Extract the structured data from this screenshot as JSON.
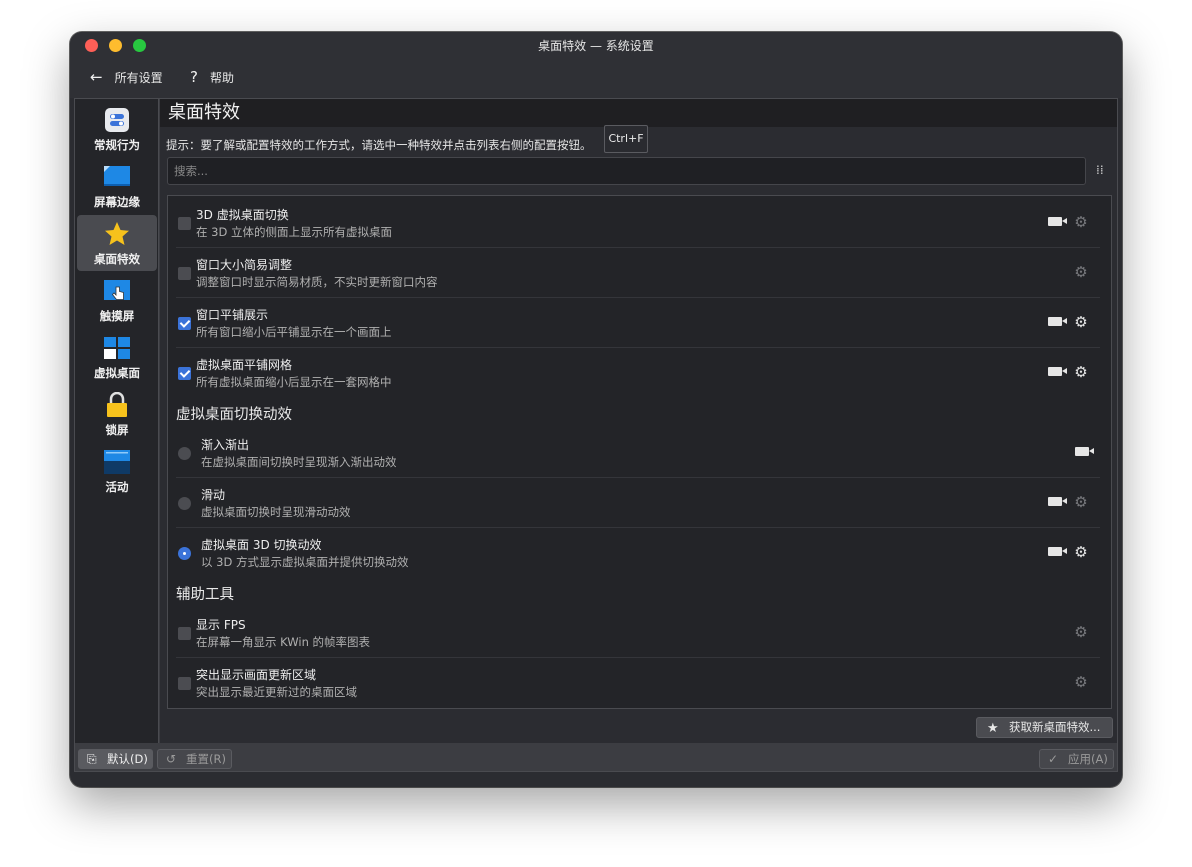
{
  "window": {
    "title": "桌面特效 — 系统设置"
  },
  "toolbar": {
    "back_label": "所有设置",
    "help_label": "帮助"
  },
  "sidebar": {
    "items": [
      {
        "label": "常规行为",
        "icon": "general-behavior-icon",
        "active": false
      },
      {
        "label": "屏幕边缘",
        "icon": "screen-edges-icon",
        "active": false
      },
      {
        "label": "桌面特效",
        "icon": "star-icon",
        "active": true
      },
      {
        "label": "触摸屏",
        "icon": "touchscreen-icon",
        "active": false
      },
      {
        "label": "虚拟桌面",
        "icon": "virtual-desktops-icon",
        "active": false
      },
      {
        "label": "锁屏",
        "icon": "lock-icon",
        "active": false
      },
      {
        "label": "活动",
        "icon": "activities-icon",
        "active": false
      }
    ]
  },
  "page": {
    "title": "桌面特效",
    "hint": "提示：要了解或配置特效的工作方式，请选中一种特效并点击列表右侧的配置按钮。",
    "tooltip": "Ctrl+F",
    "search_placeholder": "搜索..."
  },
  "effects": [
    {
      "title": "3D 虚拟桌面切换",
      "desc": "在 3D 立体的侧面上显示所有虚拟桌面",
      "checked": false,
      "video": true,
      "config_enabled": false
    },
    {
      "title": "窗口大小简易调整",
      "desc": "调整窗口时显示简易材质，不实时更新窗口内容",
      "checked": false,
      "video": false,
      "config_enabled": false
    },
    {
      "title": "窗口平铺展示",
      "desc": "所有窗口缩小后平铺显示在一个画面上",
      "checked": true,
      "video": true,
      "config_enabled": true
    },
    {
      "title": "虚拟桌面平铺网格",
      "desc": "所有虚拟桌面缩小后显示在一套网格中",
      "checked": true,
      "video": true,
      "config_enabled": true
    }
  ],
  "sections": {
    "desktop_switch": "虚拟桌面切换动效",
    "accessibility": "辅助工具"
  },
  "switch_animations": [
    {
      "title": "渐入渐出",
      "desc": "在虚拟桌面间切换时呈现渐入渐出动效",
      "selected": false,
      "video": true,
      "config": false
    },
    {
      "title": "滑动",
      "desc": "虚拟桌面切换时呈现滑动动效",
      "selected": false,
      "video": true,
      "config": true,
      "config_enabled": false
    },
    {
      "title": "虚拟桌面 3D 切换动效",
      "desc": "以 3D 方式显示虚拟桌面并提供切换动效",
      "selected": true,
      "video": true,
      "config": true,
      "config_enabled": true
    }
  ],
  "tools": [
    {
      "title": "显示 FPS",
      "desc": "在屏幕一角显示 KWin 的帧率图表",
      "checked": false,
      "config_enabled": false
    },
    {
      "title": "突出显示画面更新区域",
      "desc": "突出显示最近更新过的桌面区域",
      "checked": false,
      "config_enabled": false
    }
  ],
  "buttons": {
    "get_new": "获取新桌面特效...",
    "default": "默认(D)",
    "reset": "重置(R)",
    "apply": "应用(A)"
  }
}
